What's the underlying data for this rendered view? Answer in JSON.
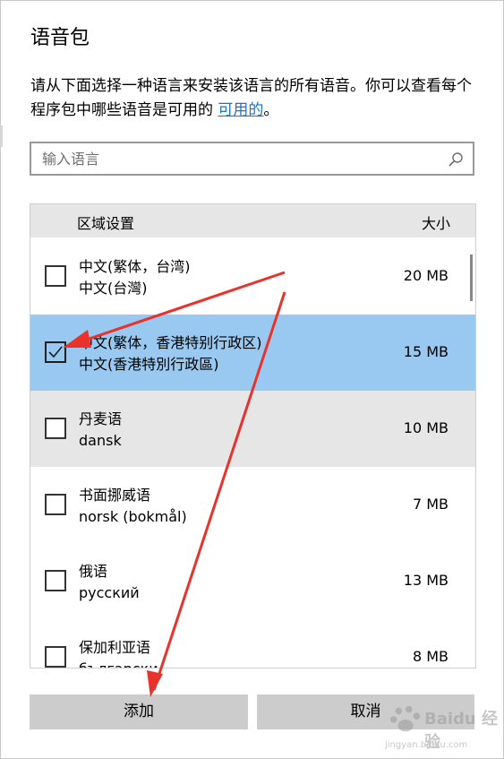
{
  "dialog": {
    "title": "语音包",
    "description": "请从下面选择一种语言来安装该语言的所有语音。你可以查看每个程序包中哪些语音是可用的",
    "link": "可用的",
    "description_end": "。"
  },
  "search": {
    "placeholder": "输入语言",
    "icon": "search-icon"
  },
  "list": {
    "header_region": "区域设置",
    "header_size": "大小",
    "rows": [
      {
        "name": "中文(繁体，台湾)",
        "native": "中文(台灣)",
        "size": "20 MB",
        "checked": false
      },
      {
        "name": "中文(繁体，香港特别行政区)",
        "native": "中文(香港特別行政區)",
        "size": "15 MB",
        "checked": true
      },
      {
        "name": "丹麦语",
        "native": "dansk",
        "size": "10 MB",
        "checked": false
      },
      {
        "name": "书面挪威语",
        "native": "norsk (bokmål)",
        "size": "7 MB",
        "checked": false
      },
      {
        "name": "俄语",
        "native": "русский",
        "size": "13 MB",
        "checked": false
      },
      {
        "name": "保加利亚语",
        "native": "български",
        "size": "8 MB",
        "checked": false
      }
    ]
  },
  "buttons": {
    "add": "添加",
    "cancel": "取消"
  },
  "colors": {
    "selected_row": "#99c9f0",
    "hover_row": "#e6e6e6",
    "button": "#cccccc",
    "link": "#1a73c8",
    "annotation_arrow": "#e8322b"
  },
  "watermark": {
    "text": "Baidu 经验",
    "url": "jingyan.baidu.com"
  }
}
